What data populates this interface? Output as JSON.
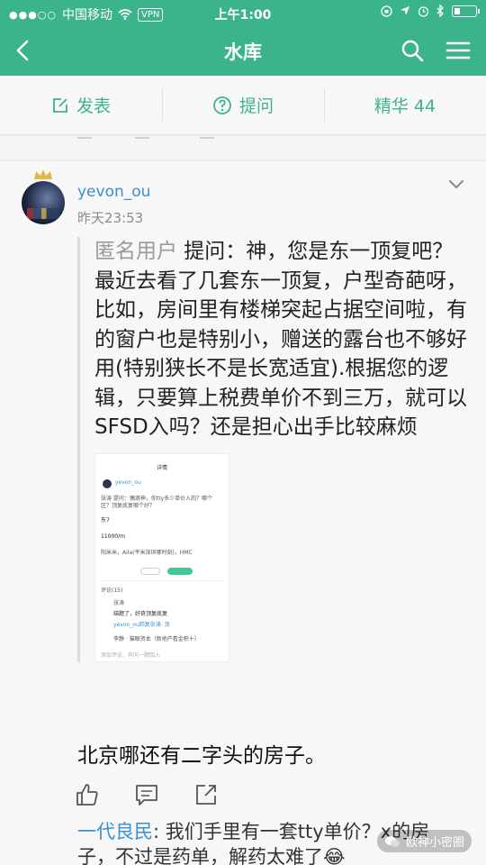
{
  "status_bar": {
    "carrier": "中国移动",
    "vpn": "VPN",
    "time": "上午1:00"
  },
  "header": {
    "title": "水库",
    "back_icon": "chevron-left-icon",
    "search_icon": "search-icon",
    "menu_icon": "hamburger-menu-icon",
    "bg_color": "#3cb48a"
  },
  "tabs": [
    {
      "label": "发表",
      "icon": "edit-icon"
    },
    {
      "label": "提问",
      "icon": "question-icon"
    },
    {
      "label": "精华 44",
      "icon": ""
    }
  ],
  "post": {
    "author": "yevon_ou",
    "time": "昨天23:53",
    "quote": {
      "anon_user": "匿名用户",
      "question": " 提问：神，您是东一顶复吧？最近去看了几套东一顶复，户型奇葩呀，比如，房间里有楼梯突起占据空间啦，有的窗户也是特别小，赠送的露台也不够好用(特别狭长不是长宽适宜).根据您的逻辑，只要算上税费单价不到三万，就可以SFSD入吗？还是担心出手比较麻烦"
    },
    "screenshot": {
      "header": "详情",
      "author": "yevon_ou",
      "question": "张涛 提问：偶滴神，你tty多少单价入的？哪个区？顶复底复哪个好？",
      "answer": "东7",
      "price": "11000/m",
      "detail": "阳米米，Aila(平米深圳哪时刻)，HMC",
      "comment_label": "评论(15)",
      "commenter": "张涛",
      "comment": "结题了，好奇顶复底复",
      "reply_line": "yevon_ou回复张涛: 顶",
      "other": "李静 · 猫眼资本（新地产看金积十）",
      "input_placeholder": "添加评论，有问一题回入"
    },
    "answer": "北京哪还有二字头的房子。",
    "actions": [
      "like-icon",
      "comment-icon",
      "share-icon"
    ]
  },
  "reply": {
    "name": "一代良民",
    "text": ": 我们手里有一套tty单价？x的房子，不过是药单，解药太难了😂"
  },
  "watermark": "欧神小密圈"
}
